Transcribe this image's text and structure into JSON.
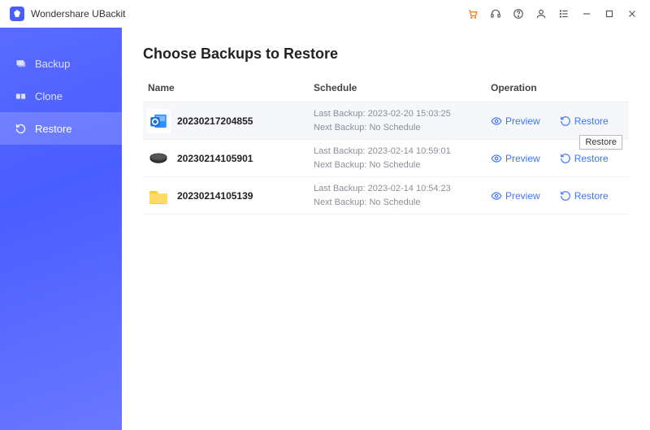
{
  "app": {
    "title": "Wondershare UBackit"
  },
  "sidebar": {
    "items": [
      {
        "label": "Backup"
      },
      {
        "label": "Clone"
      },
      {
        "label": "Restore"
      }
    ]
  },
  "main": {
    "heading": "Choose Backups to Restore",
    "columns": {
      "name": "Name",
      "schedule": "Schedule",
      "operation": "Operation"
    },
    "preview_label": "Preview",
    "restore_label": "Restore",
    "tooltip": "Restore",
    "rows": [
      {
        "name": "20230217204855",
        "last": "Last Backup: 2023-02-20 15:03:25",
        "next": "Next Backup: No Schedule",
        "icon": "outlook"
      },
      {
        "name": "20230214105901",
        "last": "Last Backup: 2023-02-14 10:59:01",
        "next": "Next Backup: No Schedule",
        "icon": "disk"
      },
      {
        "name": "20230214105139",
        "last": "Last Backup: 2023-02-14 10:54:23",
        "next": "Next Backup: No Schedule",
        "icon": "folder"
      }
    ]
  }
}
